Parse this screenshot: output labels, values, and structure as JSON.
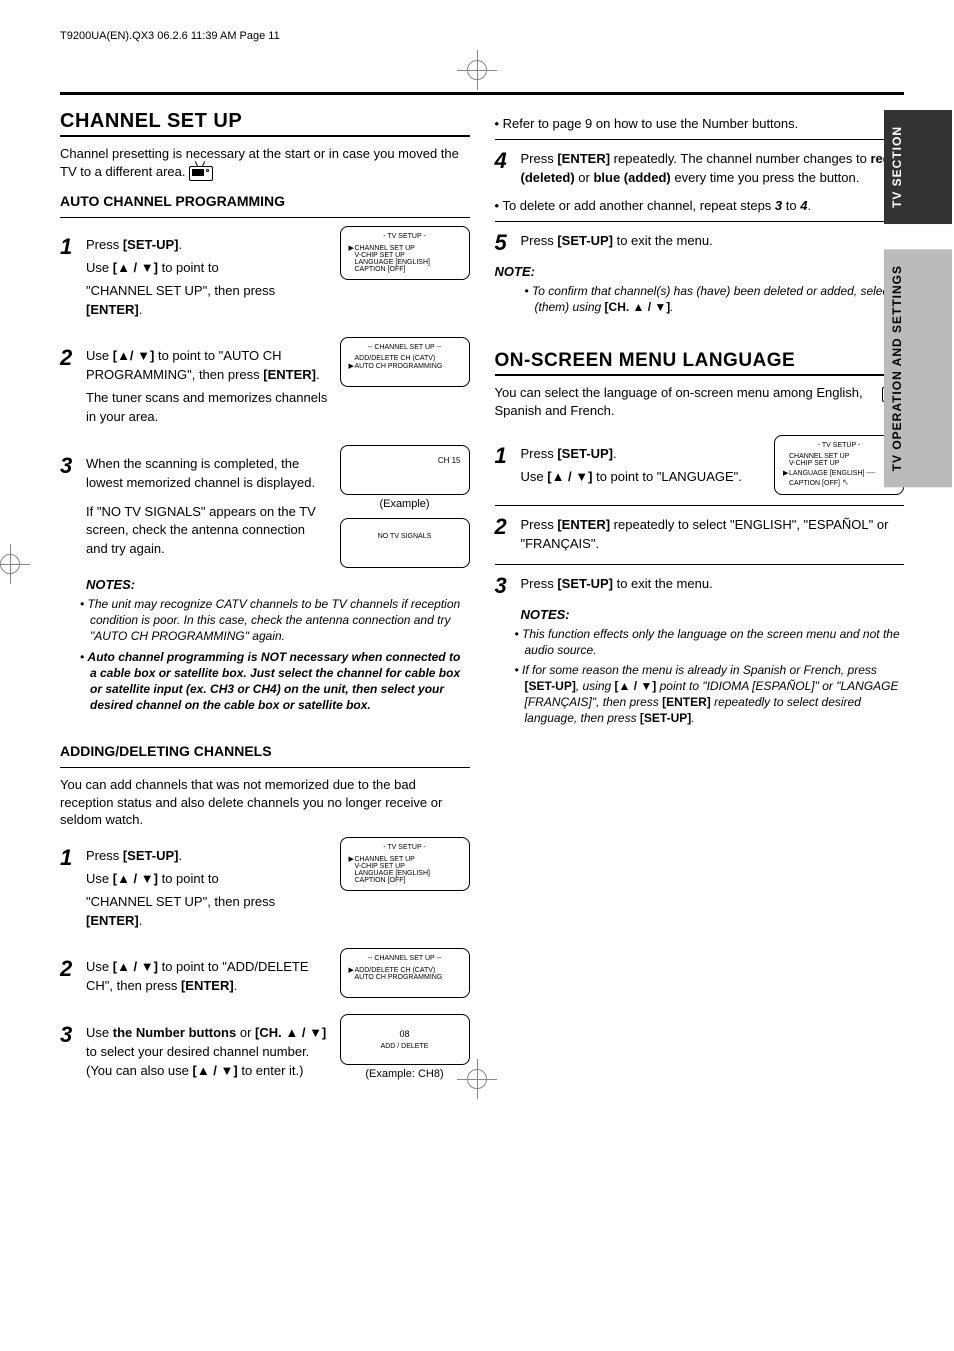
{
  "file_header": "T9200UA(EN).QX3  06.2.6  11:39 AM  Page 11",
  "tabs": {
    "top": "TV SECTION",
    "bottom": "TV OPERATION AND SETTINGS"
  },
  "page_number": "11",
  "page_lang": "EN",
  "left": {
    "h1": "CHANNEL SET UP",
    "intro": "Channel presetting is necessary at the start or in case you moved the TV to a different area.",
    "h2a": "AUTO CHANNEL PROGRAMMING",
    "s1": {
      "a": "Press ",
      "b": "[SET-UP]",
      "c": ".",
      "d1": "Use ",
      "d2": "[▲ / ▼]",
      "d3": " to point to",
      "e": "\"CHANNEL SET UP\", then press ",
      "f": "[ENTER]",
      "g": "."
    },
    "s2": {
      "a": "Use ",
      "b": "[▲/ ▼]",
      "c": " to point to \"AUTO CH PROGRAMMING\", then press ",
      "d": "[ENTER]",
      "e": ".",
      "f": "The tuner scans and memorizes channels in your area."
    },
    "s3": {
      "a": "When the scanning is completed, the lowest memorized channel is displayed.",
      "b": "If \"NO TV SIGNALS\" appears on the TV screen, check the antenna connection and try again."
    },
    "notes_title": "NOTES:",
    "note1": "The unit may recognize CATV channels to be TV channels if reception condition is poor. In this case, check the antenna connection and try \"AUTO CH PROGRAMMING\" again.",
    "note2": "Auto channel programming is NOT necessary when connected to a cable box or satellite box. Just select the channel for cable box or satellite input (ex. CH3 or CH4) on the unit, then select your desired channel on the cable box or satellite box.",
    "h2b": "ADDING/DELETING CHANNELS",
    "intro2": "You can add channels that was not memorized due to the bad reception status and also delete channels you no longer receive or seldom watch.",
    "b2": {
      "a": "Use ",
      "b": "[▲ / ▼]",
      "c": " to point to \"ADD/DELETE CH\", then press ",
      "d": "[ENTER]",
      "e": "."
    },
    "b3": {
      "a": "Use ",
      "b": "the Number buttons",
      "c": " or ",
      "d": "[CH. ▲ / ▼]",
      "e": " to select your desired channel number. (You can also use ",
      "f": "[▲ / ▼]",
      "g": " to enter it.)"
    },
    "scr_setup_title": "- TV SETUP -",
    "scr_setup_l1": "CHANNEL SET UP",
    "scr_setup_l2": "V-CHIP SET UP",
    "scr_setup_l3": "LANGUAGE  [ENGLISH]",
    "scr_setup_l4": "CAPTION  [OFF]",
    "scr_ch_title": "-- CHANNEL SET UP --",
    "scr_ch_l1": "ADD/DELETE CH (CATV)",
    "scr_ch_l2": "AUTO CH PROGRAMMING",
    "scr_scan": "CH 15",
    "scr_scan_cap": "(Example)",
    "scr_nosig": "NO TV SIGNALS",
    "scr_add_l1": "08",
    "scr_add_l2": "ADD / DELETE",
    "scr_add_cap": "(Example: CH8)"
  },
  "right": {
    "bullet1": "Refer to page 9 on how to use the Number buttons.",
    "s4": {
      "a": "Press ",
      "b": "[ENTER]",
      "c": " repeatedly. The channel number changes to ",
      "d": "red (deleted)",
      "e": " or ",
      "f": "blue (added)",
      "g": " every time you press the button."
    },
    "bullet2a": "To delete or add another channel, repeat steps ",
    "bullet2b": "3",
    "bullet2c": " to ",
    "bullet2d": "4",
    "bullet2e": ".",
    "s5": {
      "a": "Press ",
      "b": "[SET-UP]",
      "c": " to exit the menu."
    },
    "note_title": "NOTE:",
    "note1a": "To confirm that channel(s) has (have) been deleted or added, select it (them) using ",
    "note1b": "[CH. ▲ / ▼]",
    "note1c": ".",
    "h1": "ON-SCREEN MENU LANGUAGE",
    "intro": "You can select the language of on-screen menu among English, Spanish and French.",
    "l1": {
      "a": "Press ",
      "b": "[SET-UP]",
      "c": ".",
      "d": "Use ",
      "e": "[▲ / ▼]",
      "f": " to point to \"LANGUAGE\"."
    },
    "l2": {
      "a": "Press ",
      "b": "[ENTER]",
      "c": " repeatedly to select \"ENGLISH\", \"ESPAÑOL\" or \"FRANÇAIS\"."
    },
    "l3": {
      "a": "Press ",
      "b": "[SET-UP]",
      "c": " to exit the menu."
    },
    "notes_title": "NOTES:",
    "ln1": "This function effects only the language on the screen menu and not the audio source.",
    "ln2a": "If for some reason the menu is already in Spanish or French, press ",
    "ln2b": "[SET-UP]",
    "ln2c": ", using ",
    "ln2d": "[▲ / ▼]",
    "ln2e": " point to \"IDIOMA [ESPAÑOL]\" or \"LANGAGE [FRANÇAIS]\", then press ",
    "ln2f": "[ENTER]",
    "ln2g": " repeatedly to select desired language, then press ",
    "ln2h": "[SET-UP]",
    "ln2i": "."
  }
}
